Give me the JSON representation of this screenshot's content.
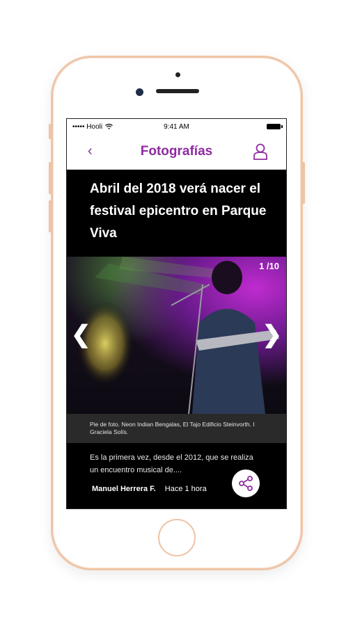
{
  "status_bar": {
    "carrier": "••••• Hooli",
    "time": "9:41 AM"
  },
  "nav": {
    "back_icon": "chevron-left-icon",
    "title": "Fotografías",
    "user_icon": "user-icon"
  },
  "article": {
    "headline": "Abril del 2018 verá nacer el festival epicentro en Parque Viva",
    "gallery": {
      "counter": "1 /10",
      "prev_icon": "chevron-left-icon",
      "next_icon": "chevron-right-icon"
    },
    "caption": "Pie de foto. Neon Indian Bengalas, El Tajo Edificio Steinvorth. I Graciela Solís.",
    "teaser": "Es la primera vez, desde el 2012, que se realiza un encuentro musical de....",
    "author": "Manuel Herrera F.",
    "time_ago": "Hace 1 hora",
    "share_icon": "share-icon"
  },
  "colors": {
    "accent": "#8e2ba0",
    "frame": "#efc5a8"
  }
}
